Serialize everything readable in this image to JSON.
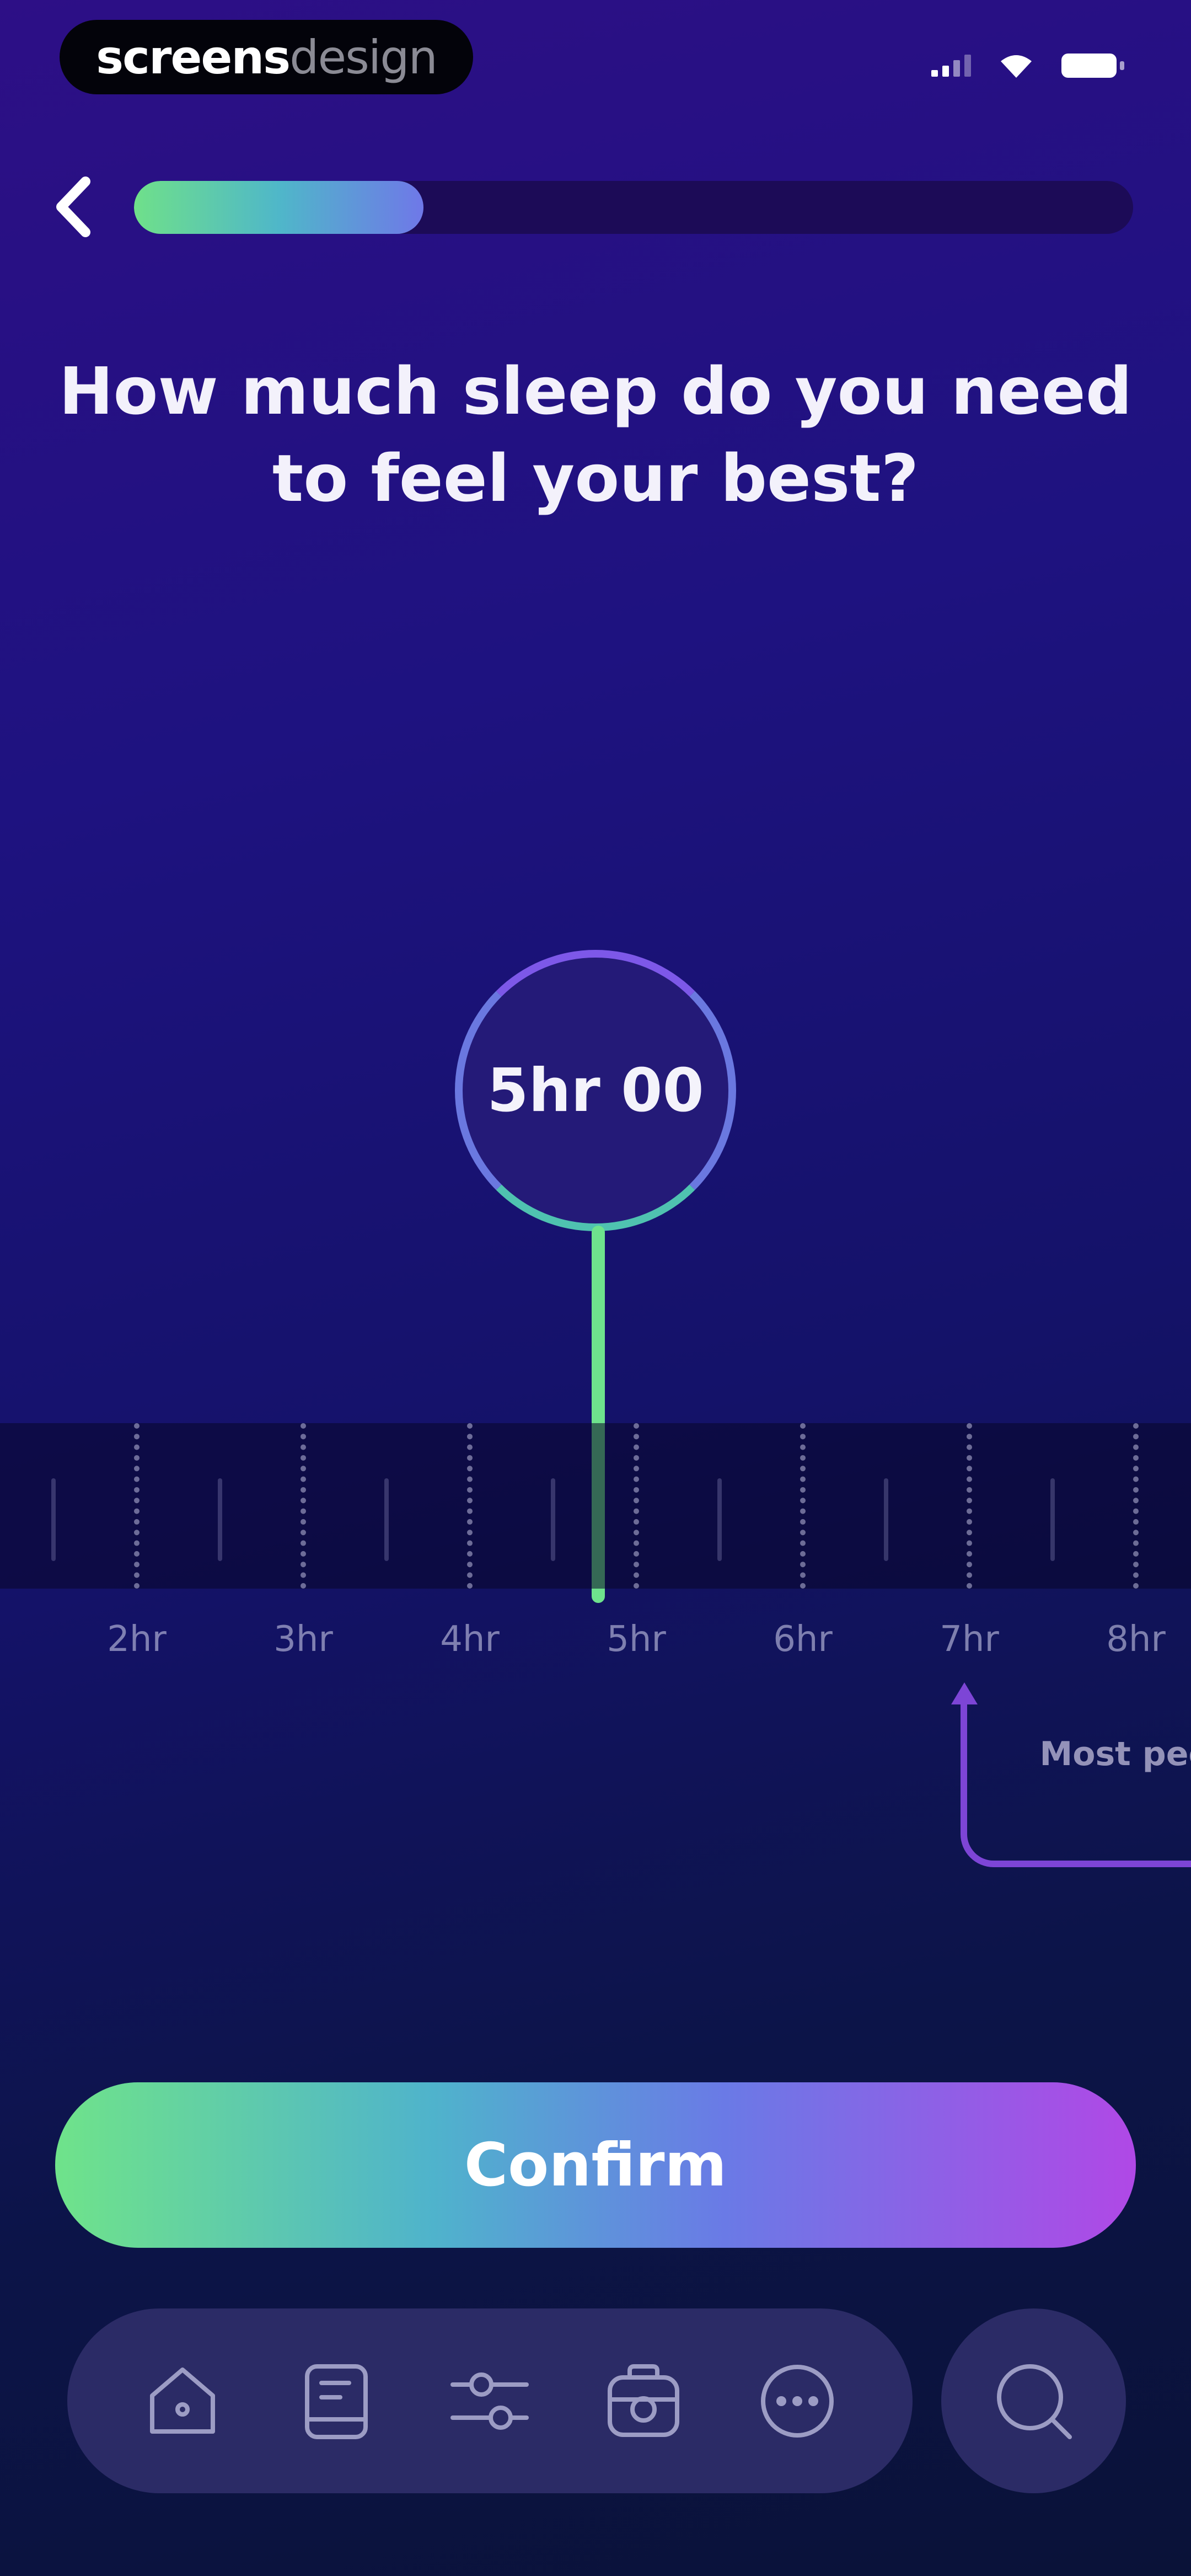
{
  "status_bar": {
    "brand_part1": "screens",
    "brand_part2": "design"
  },
  "onboarding": {
    "progress_fraction": 0.29
  },
  "question": {
    "title": "How much sleep do you need to feel your best?"
  },
  "picker": {
    "value_label": "5hr 00",
    "selected_hours": 4.75,
    "tick_labels": [
      "2hr",
      "3hr",
      "4hr",
      "5hr",
      "6hr",
      "7hr",
      "8hr"
    ]
  },
  "recommendation": {
    "text": "Most peo your ag"
  },
  "actions": {
    "confirm_label": "Confirm"
  },
  "nav": {
    "items": [
      "home-icon",
      "journal-icon",
      "sliders-icon",
      "radio-icon",
      "more-icon"
    ],
    "search_icon": "search-icon"
  },
  "colors": {
    "accent_green": "#6fe08a",
    "accent_blue": "#6a78e0",
    "accent_purple": "#b048e6"
  }
}
